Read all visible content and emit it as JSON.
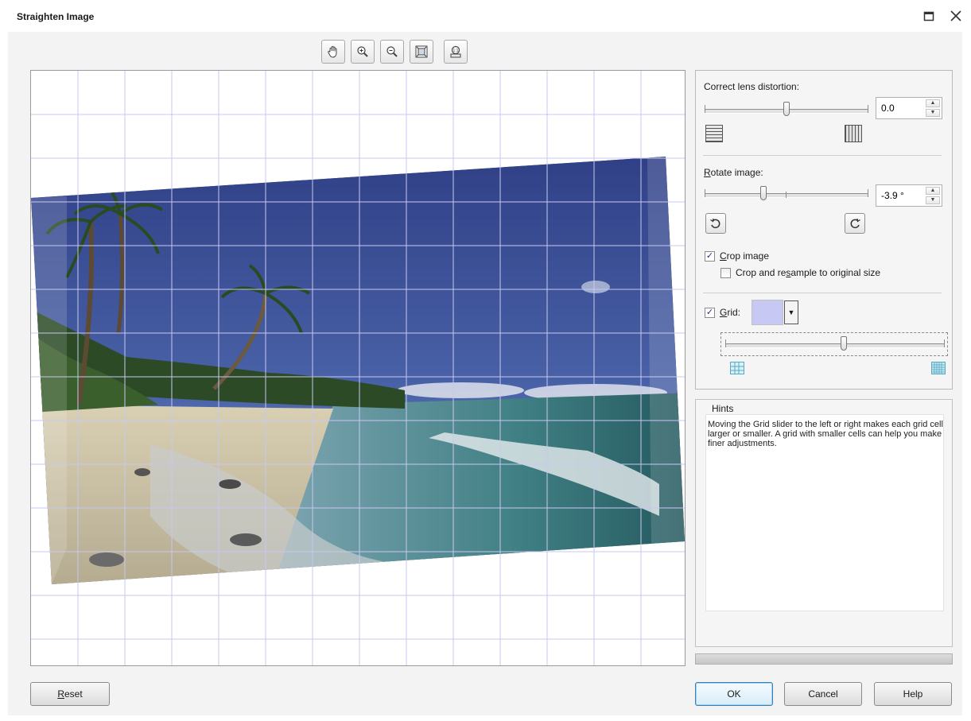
{
  "window": {
    "title": "Straighten Image",
    "maximize_icon": "maximize-icon",
    "close_icon": "close-icon"
  },
  "toolbar": [
    {
      "name": "pan-tool",
      "icon": "hand-icon"
    },
    {
      "name": "zoom-in-tool",
      "icon": "zoom-in-icon"
    },
    {
      "name": "zoom-out-tool",
      "icon": "zoom-out-icon"
    },
    {
      "name": "fit-to-window-tool",
      "icon": "fit-window-icon"
    },
    {
      "name": "actual-size-tool",
      "icon": "actual-size-icon"
    }
  ],
  "preview": {
    "grid_color": "#c8c8f0",
    "image_icon": "beach-photo"
  },
  "controls": {
    "lens": {
      "label": "Correct lens distortion:",
      "value": "0.0",
      "slider_level": 0.5,
      "left_icon": "pincushion-grid-icon",
      "right_icon": "barrel-grid-icon"
    },
    "rotate": {
      "label_prefix": "",
      "label_access_key": "R",
      "label_rest": "otate image:",
      "value": "-3.9 °",
      "slider_level": 0.36,
      "left_icon": "rotate-counterclockwise-icon",
      "right_icon": "rotate-clockwise-icon"
    },
    "crop": {
      "label_access_key": "C",
      "label_rest": "rop image",
      "checked": true,
      "resample_prefix": "Crop and re",
      "resample_access_key": "s",
      "resample_rest": "ample to original size",
      "resample_checked": false
    },
    "grid": {
      "label_access_key": "G",
      "label_rest": "rid:",
      "checked": true,
      "color": "#c8c8f5",
      "slider_level": 0.55,
      "left_icon": "large-grid-icon",
      "right_icon": "small-grid-icon"
    }
  },
  "hints": {
    "title": "Hints",
    "text": "Moving the Grid slider to the left or right makes each grid cell larger or smaller. A grid with smaller cells can help you make finer adjustments."
  },
  "buttons": {
    "reset_access_key": "R",
    "reset_rest": "eset",
    "ok": "OK",
    "cancel": "Cancel",
    "help": "Help"
  }
}
